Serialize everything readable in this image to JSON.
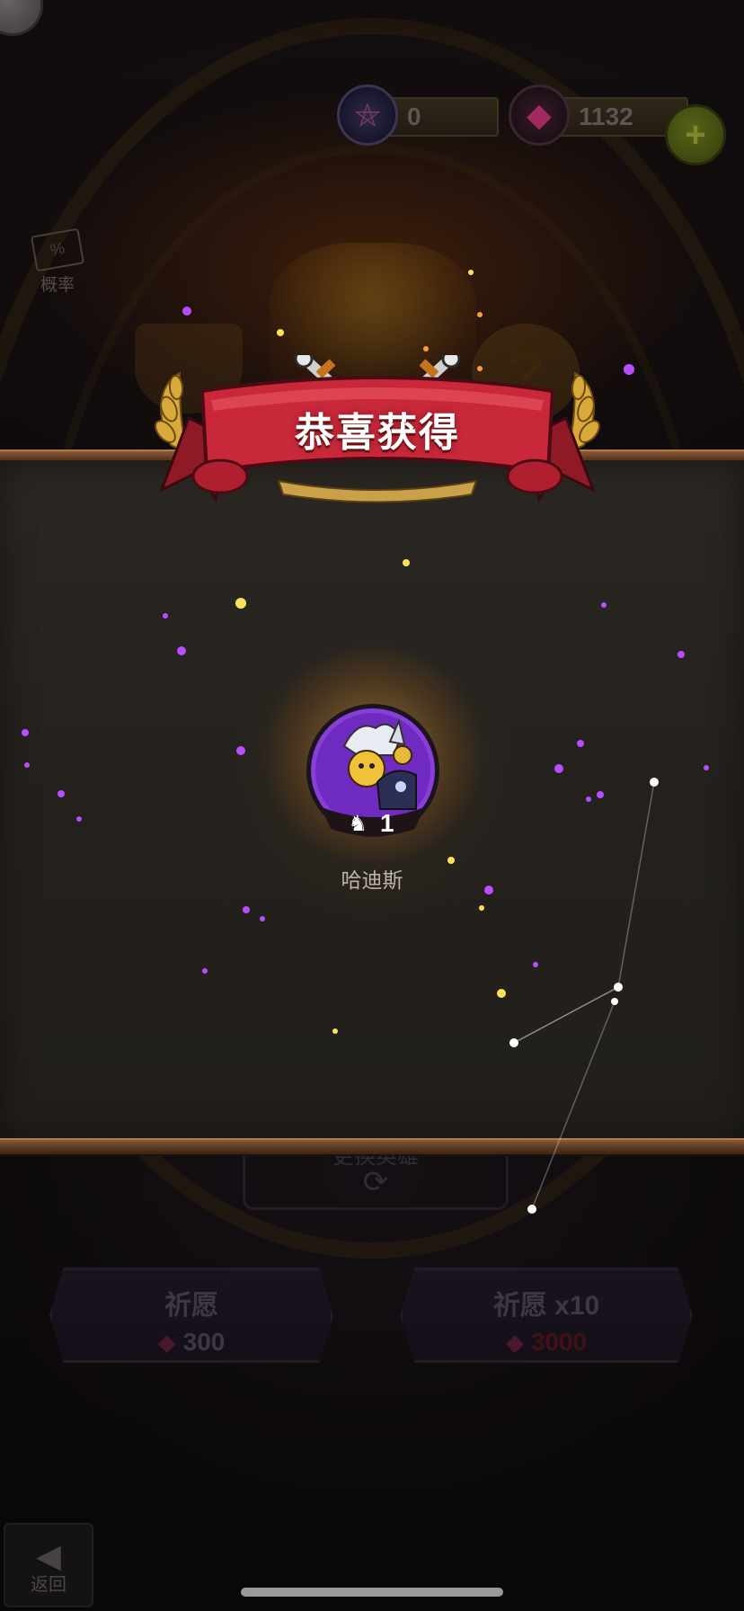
{
  "header": {
    "pentacle_count": "0",
    "gem_count": "1132",
    "plus_icon": "plus-icon"
  },
  "side": {
    "probability_label": "概率"
  },
  "reward": {
    "title": "恭喜获得",
    "hero_name": "哈迪斯",
    "hero_quantity": "1"
  },
  "bottom": {
    "change_hero_label": "更换英雄",
    "wish_label": "祈愿",
    "wish_cost": "300",
    "wish10_label": "祈愿 x10",
    "wish10_cost": "3000",
    "back_label": "返回"
  },
  "colors": {
    "banner_red": "#c8283a",
    "gold": "#d9a93a",
    "particle_purple": "#b040ff",
    "particle_gold": "#ffd84a"
  }
}
